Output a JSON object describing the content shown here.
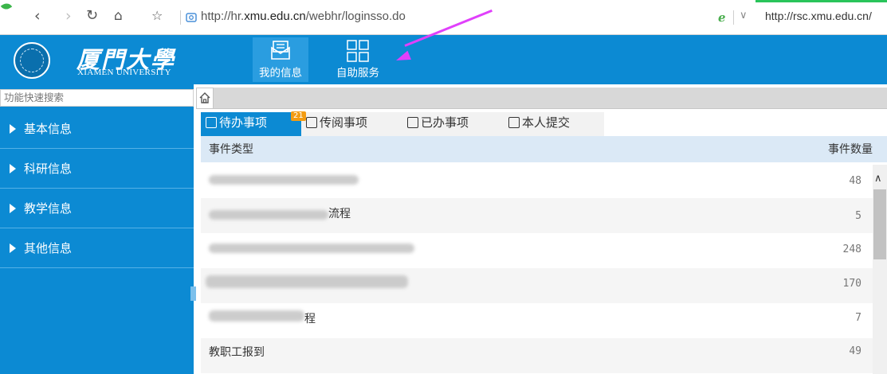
{
  "browser": {
    "back_icon": "back-arrow-icon",
    "forward_icon": "forward-arrow-icon",
    "url_prefix": "http://hr.",
    "url_domain": "xmu.edu.cn",
    "url_path": "/webhr/loginsso.do",
    "right_url": "http://rsc.xmu.edu.cn/"
  },
  "logo": {
    "chinese": "厦門大學",
    "english": "XIAMEN UNIVERSITY"
  },
  "header_nav": [
    {
      "label": "我的信息",
      "icon": "envelope-icon"
    },
    {
      "label": "自助服务",
      "icon": "grid-icon"
    }
  ],
  "sidebar": {
    "search_placeholder": "功能快速搜索",
    "items": [
      {
        "label": "基本信息"
      },
      {
        "label": "科研信息"
      },
      {
        "label": "教学信息"
      },
      {
        "label": "其他信息"
      }
    ]
  },
  "tabs": [
    {
      "label": "待办事项"
    },
    {
      "label": "传阅事项"
    },
    {
      "label": "已办事项"
    },
    {
      "label": "本人提交"
    }
  ],
  "badge": "21",
  "table": {
    "columns": [
      "事件类型",
      "事件数量"
    ],
    "rows": [
      {
        "name": "",
        "count": "48"
      },
      {
        "name": "流程",
        "count": "5"
      },
      {
        "name": "",
        "count": "248"
      },
      {
        "name": "",
        "count": "170"
      },
      {
        "name": "程",
        "count": "7"
      },
      {
        "name": "教职工报到",
        "count": "49"
      }
    ]
  },
  "colors": {
    "primary": "#0c8ad3",
    "annotation_arrow": "#e040fb",
    "badge": "#f39c12"
  }
}
